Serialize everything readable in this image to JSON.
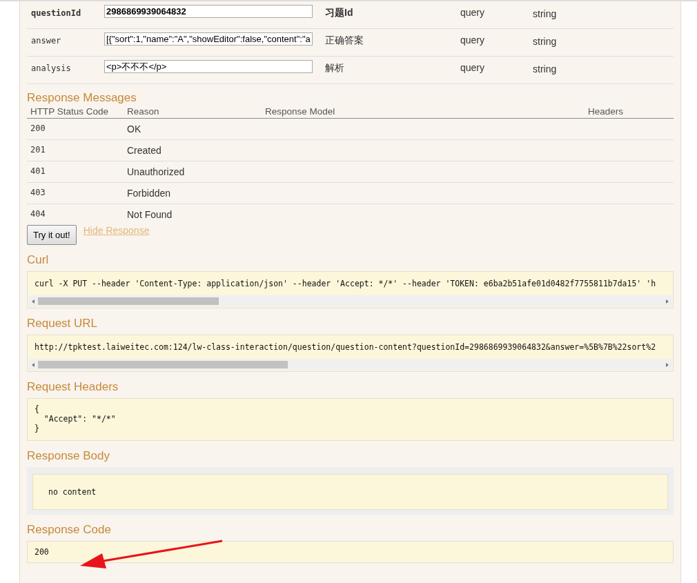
{
  "parameters": [
    {
      "name": "questionId",
      "value": "2986869939064832",
      "description": "习题Id",
      "param_type": "query",
      "data_type": "string",
      "required": true
    },
    {
      "name": "answer",
      "value": "[{\"sort\":1,\"name\":\"A\",\"showEditor\":false,\"content\":\"a",
      "description": "正确答案",
      "param_type": "query",
      "data_type": "string",
      "required": false
    },
    {
      "name": "analysis",
      "value": "<p>不不不</p>",
      "description": "解析",
      "param_type": "query",
      "data_type": "string",
      "required": false
    }
  ],
  "response_messages": {
    "title": "Response Messages",
    "columns": [
      "HTTP Status Code",
      "Reason",
      "Response Model",
      "Headers"
    ],
    "rows": [
      {
        "code": "200",
        "reason": "OK"
      },
      {
        "code": "201",
        "reason": "Created"
      },
      {
        "code": "401",
        "reason": "Unauthorized"
      },
      {
        "code": "403",
        "reason": "Forbidden"
      },
      {
        "code": "404",
        "reason": "Not Found"
      }
    ]
  },
  "try_button": "Try it out!",
  "hide_link": "Hide Response",
  "sections": [
    {
      "kind": "scroll",
      "title": "Curl",
      "code": "curl -X PUT --header 'Content-Type: application/json' --header 'Accept: */*' --header 'TOKEN: e6ba2b51afe01d0482f7755811b7da15' 'h"
    },
    {
      "kind": "scroll",
      "title": "Request URL",
      "code": "http://tpktest.laiweitec.com:124/lw-class-interaction/question/question-content?questionId=2986869939064832&answer=%5B%7B%22sort%2"
    },
    {
      "kind": "block",
      "title": "Request Headers",
      "code": "{\n  \"Accept\": \"*/*\"\n}"
    },
    {
      "kind": "nested",
      "title": "Response Body",
      "code": "no content"
    },
    {
      "kind": "plain",
      "title": "Response Code",
      "code": "200"
    }
  ]
}
